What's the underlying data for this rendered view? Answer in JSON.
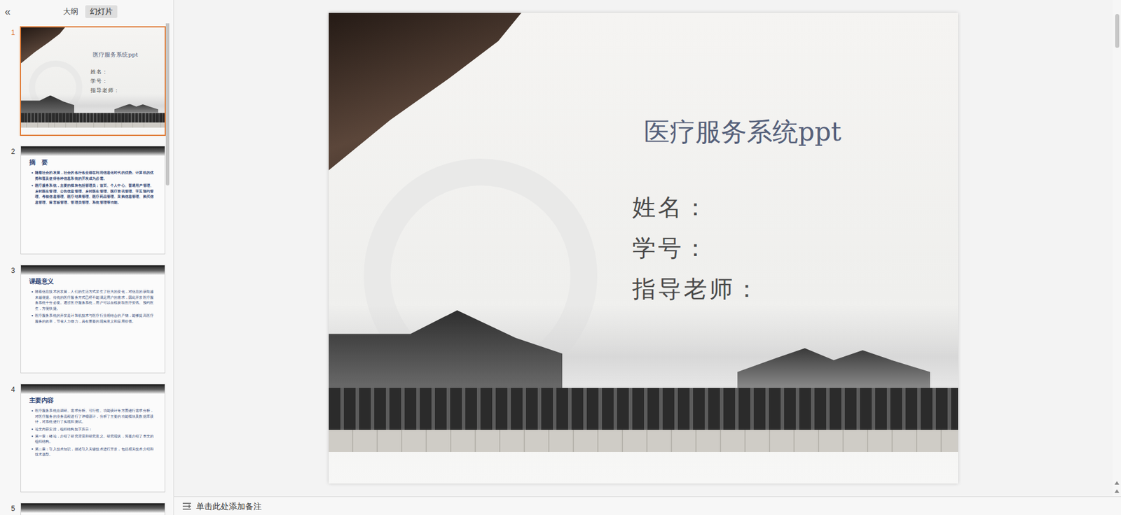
{
  "panel": {
    "collapse_icon": "«",
    "tabs": [
      {
        "label": "大纲",
        "selected": false
      },
      {
        "label": "幻灯片",
        "selected": true
      }
    ]
  },
  "slides": [
    {
      "number": "1",
      "selected": true,
      "kind": "title",
      "title": "医疗服务系统ppt",
      "fields": [
        "姓名：",
        "学号：",
        "指导老师："
      ]
    },
    {
      "number": "2",
      "selected": false,
      "kind": "content",
      "bold": true,
      "title": "摘　要",
      "bullets": [
        "随着社会的发展，社会的各行各业都在利用信息化时代的优势。计算机的优势和普及使得各种信息系统的开发成为必需。",
        "医疗服务系统，主要的模块包括管理员；首页、个人中心、普通用户管理、乡村医生管理、公告信息管理、乡村医生管理、医疗资讯管理、字互预约管理、考核信息管理、医疗结果管理、医疗药品管理、采购信息管理、购买信息管理、留言板管理、管理员管理、系统管理等功能。"
      ]
    },
    {
      "number": "3",
      "selected": false,
      "kind": "content",
      "bold": false,
      "title": "课题意义",
      "bullets": [
        "随着信息技术的发展，人们的生活方式发生了巨大的变化，对信息的获取越来越便捷。传统的医疗服务方式已经不能满足用户的需求，因此开发医疗服务系统十分必要。通过医疗服务系统，用户可以在线获取医疗资讯、预约医生，方便快捷。",
        "医疗服务系统的开发是计算机技术与医疗行业相结合的产物，能够提高医疗服务的效率，节省人力物力，具有重要的现实意义和应用价值。"
      ]
    },
    {
      "number": "4",
      "selected": false,
      "kind": "content",
      "bold": false,
      "title": "主要内容",
      "bullets": [
        "医疗服务系统在调研、需求分析、可行性、功能设计等方面进行需求分析，对医疗服务的业务流程进行了详细设计，分析了主要的功能模块及数据库设计，对系统进行了实现和测试。",
        "论文内容安排，组织结构如下所示：",
        "第一章：绪论，介绍了研究背景和研究意义、研究现状，简要介绍了本文的组织结构。",
        "第二章：引入技术知识，描述引入关键技术进行开发，包括相关技术介绍和技术选型。"
      ]
    },
    {
      "number": "5",
      "selected": false,
      "kind": "content",
      "bold": false,
      "bullets": []
    }
  ],
  "notes": {
    "placeholder": "单击此处添加备注"
  }
}
